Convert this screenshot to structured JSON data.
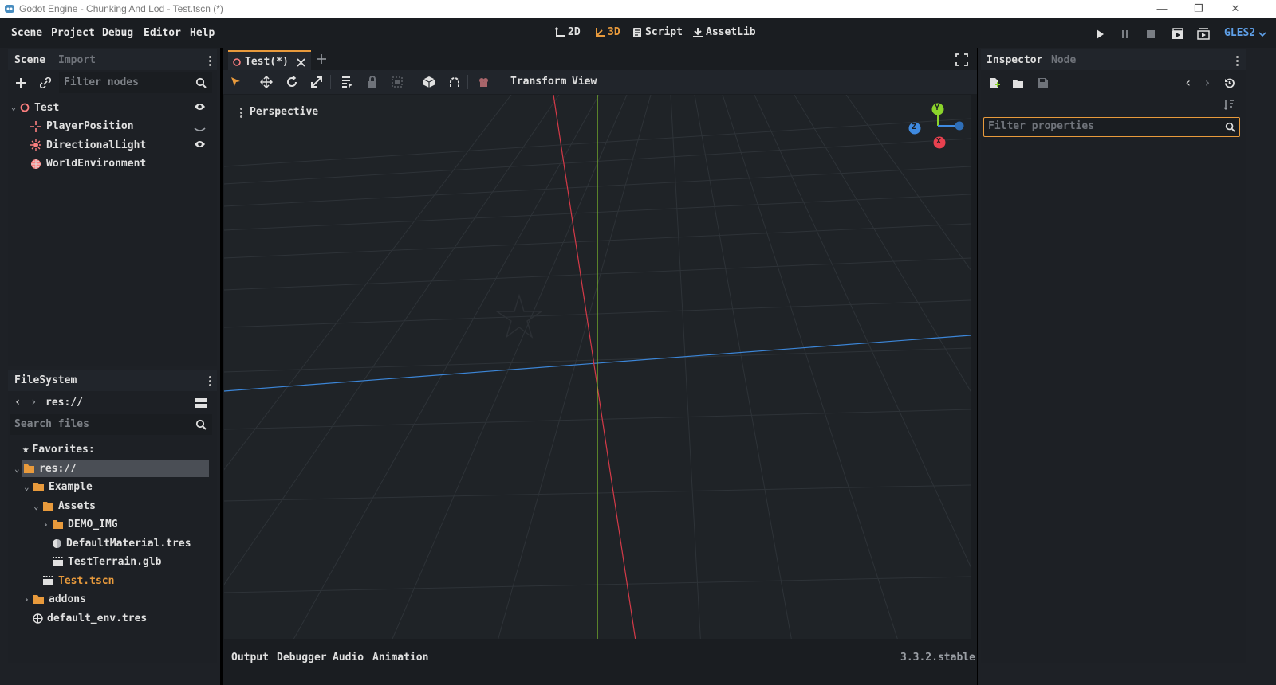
{
  "window": {
    "title": "Godot Engine - Chunking And Lod - Test.tscn (*)",
    "controls": [
      "—",
      "❐",
      "✕"
    ]
  },
  "menubar": {
    "items": [
      "Scene",
      "Project",
      "Debug",
      "Editor",
      "Help"
    ],
    "workspaces": [
      {
        "label": "2D",
        "active": false
      },
      {
        "label": "3D",
        "active": true
      },
      {
        "label": "Script",
        "active": false
      },
      {
        "label": "AssetLib",
        "active": false
      }
    ],
    "renderer": "GLES2"
  },
  "scene_dock": {
    "tabs": [
      "Scene",
      "Import"
    ],
    "filter_placeholder": "Filter nodes",
    "nodes": [
      {
        "name": "Test",
        "icon": "spatial-node-icon",
        "level": 0,
        "visible_toggle": true
      },
      {
        "name": "PlayerPosition",
        "icon": "position3d-icon",
        "level": 1,
        "visible_toggle": false
      },
      {
        "name": "DirectionalLight",
        "icon": "light-icon",
        "level": 1,
        "visible_toggle": true
      },
      {
        "name": "WorldEnvironment",
        "icon": "globe-icon",
        "level": 1,
        "visible_toggle": false
      }
    ]
  },
  "filesystem_dock": {
    "title": "FileSystem",
    "path": "res://",
    "search_placeholder": "Search files",
    "favorites_label": "Favorites:",
    "items": [
      {
        "name": "res://",
        "type": "folder",
        "level": 0,
        "selected": true
      },
      {
        "name": "Example",
        "type": "folder",
        "level": 1
      },
      {
        "name": "Assets",
        "type": "folder",
        "level": 2
      },
      {
        "name": "DEMO_IMG",
        "type": "folder",
        "level": 3,
        "collapsed": true
      },
      {
        "name": "DefaultMaterial.tres",
        "type": "material",
        "level": 3
      },
      {
        "name": "TestTerrain.glb",
        "type": "scene",
        "level": 3
      },
      {
        "name": "Test.tscn",
        "type": "scene",
        "level": 2,
        "highlight": true
      },
      {
        "name": "addons",
        "type": "folder",
        "level": 1,
        "collapsed": true
      },
      {
        "name": "default_env.tres",
        "type": "env",
        "level": 1
      }
    ]
  },
  "editor": {
    "scene_tab": "Test(*)",
    "toolbar_menus": [
      "Transform",
      "View"
    ],
    "viewport_label": "Perspective",
    "gizmo_axes": [
      "Y",
      "Z",
      "X"
    ]
  },
  "bottom_panel": {
    "tabs": [
      "Output",
      "Debugger",
      "Audio",
      "Animation"
    ],
    "version": "3.3.2.stable"
  },
  "inspector": {
    "tabs": [
      "Inspector",
      "Node"
    ],
    "filter_placeholder": "Filter properties"
  },
  "colors": {
    "accent": "#e89a3c",
    "x_axis": "#e8414f",
    "y_axis": "#8bd42b",
    "z_axis": "#3f8ae0"
  }
}
